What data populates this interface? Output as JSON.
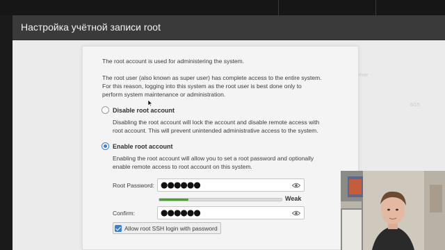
{
  "window": {
    "title": "Настройка учётной записи root"
  },
  "background_hint": {
    "ghost_right_1": "2 Server",
    "ghost_right_2": "6/15"
  },
  "dialog": {
    "intro": "The root account is used for administering the system.",
    "details_line1": "The root user (also known as super user) has complete access to the entire system.",
    "details_line2": "For this reason, logging into this system as the root user is best done only to",
    "details_line3": "perform system maintenance or administration.",
    "options": [
      {
        "label": "Disable root account",
        "selected": false,
        "desc_line1": "Disabling the root account will lock the account and disable remote access with",
        "desc_line2": "root account. This will prevent unintended administrative access to the system."
      },
      {
        "label": "Enable root account",
        "selected": true,
        "desc_line1": "Enabling the root account will allow you to set a root password and optionally",
        "desc_line2": "enable remote access to root account on this system."
      }
    ],
    "root_password": {
      "label": "Root Password:",
      "value": "●●●●●●"
    },
    "strength": {
      "label": "Weak",
      "fraction": 0.24,
      "color": "#4f9a3b"
    },
    "confirm": {
      "label": "Confirm:",
      "value": "●●●●●●"
    },
    "ssh_checkbox": {
      "label": "Allow root SSH login with password",
      "checked": true
    }
  },
  "colors": {
    "accent": "#3f7fd1",
    "titlebar": "#3a3a3a"
  }
}
